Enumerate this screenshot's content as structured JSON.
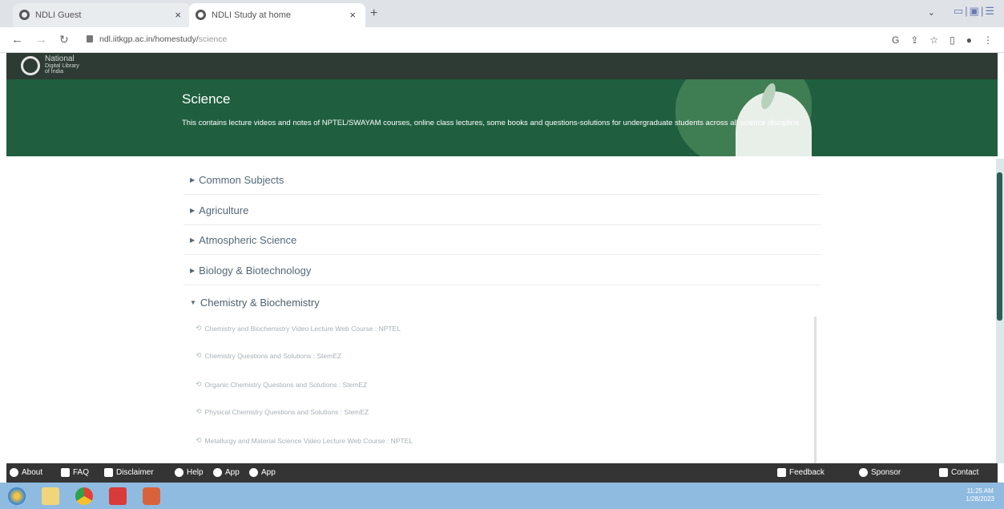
{
  "browser": {
    "tabs": [
      {
        "title": "NDLI Guest",
        "close": "×"
      },
      {
        "title": "NDLI Study at home",
        "close": "×"
      }
    ],
    "new_tab": "+",
    "url_host": "ndl.iitkgp.ac.in/homestudy/",
    "url_path": "science"
  },
  "site": {
    "logo_line1": "National",
    "logo_line2": "Digital Library",
    "logo_line3": "of India"
  },
  "hero": {
    "title": "Science",
    "description": "This contains lecture videos and notes of NPTEL/SWAYAM courses, online class lectures, some books and questions-solutions for undergraduate students across all science discipline."
  },
  "categories": [
    {
      "label": "Common Subjects",
      "expanded": false
    },
    {
      "label": "Agriculture",
      "expanded": false
    },
    {
      "label": "Atmospheric Science",
      "expanded": false
    },
    {
      "label": "Biology & Biotechnology",
      "expanded": false
    },
    {
      "label": "Chemistry & Biochemistry",
      "expanded": true
    }
  ],
  "subitems": [
    "Chemistry and Biochemistry Video Lecture Web Course : NPTEL",
    "Chemistry Questions and Solutions : StemEZ",
    "Organic Chemistry Questions and Solutions : StemEZ",
    "Physical Chemistry Questions and Solutions : StemEZ",
    "Metallurgy and Material Science Video Lecture Web Course : NPTEL"
  ],
  "footer": {
    "about": "About",
    "faq": "FAQ",
    "disclaimer": "Disclaimer",
    "help": "Help",
    "app_android": "App",
    "app_ios": "App",
    "feedback": "Feedback",
    "sponsor": "Sponsor",
    "contact": "Contact"
  },
  "taskbar": {
    "time": "11:25 AM",
    "date": "1/28/2023"
  },
  "colors": {
    "hero_green": "#1f5f3f",
    "site_bar": "#2d3b34",
    "footer_bg": "#343434",
    "category_text": "#536878"
  }
}
